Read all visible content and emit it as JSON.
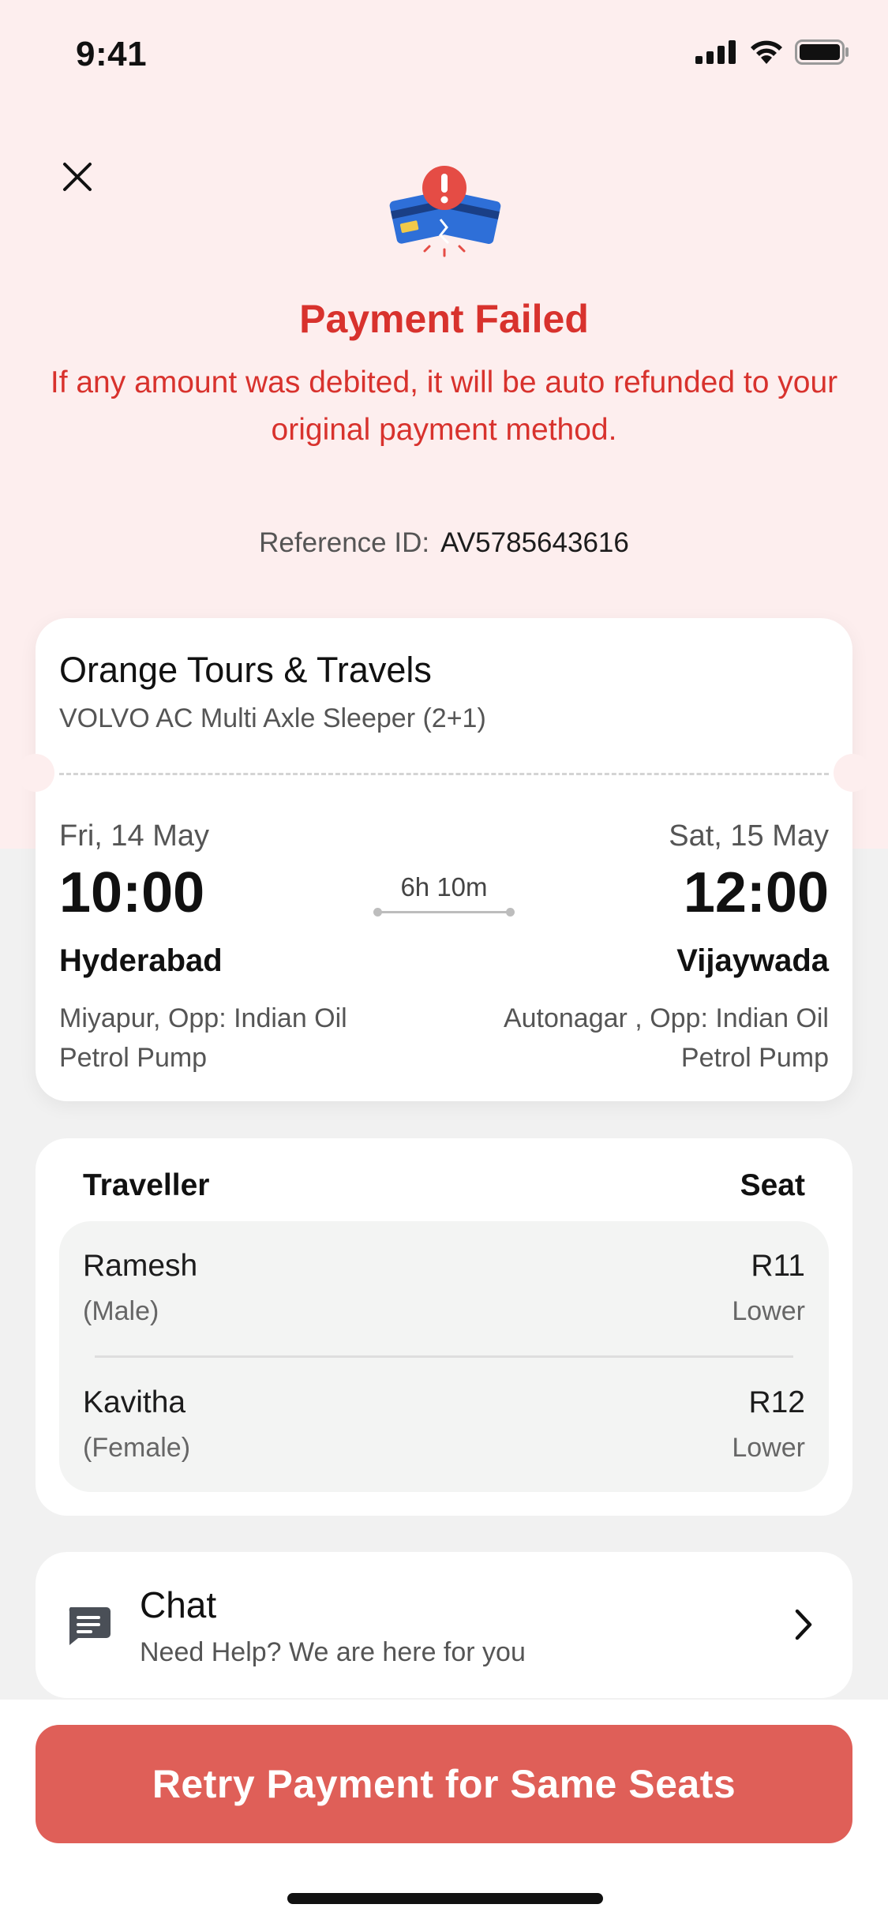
{
  "status_bar": {
    "time": "9:41"
  },
  "header": {
    "title": "Payment Failed",
    "message": "If any amount was debited, it will be auto refunded to your original payment method.",
    "reference_label": "Reference ID:",
    "reference_id": "AV5785643616"
  },
  "trip": {
    "operator": "Orange Tours & Travels",
    "bus_type": "VOLVO AC Multi Axle Sleeper (2+1)",
    "departure": {
      "date": "Fri, 14 May",
      "time": "10:00",
      "city": "Hyderabad",
      "point": "Miyapur, Opp: Indian Oil Petrol Pump"
    },
    "arrival": {
      "date": "Sat, 15 May",
      "time": "12:00",
      "city": "Vijaywada",
      "point": "Autonagar , Opp: Indian Oil Petrol Pump"
    },
    "duration": "6h 10m"
  },
  "travellers": {
    "header_traveller": "Traveller",
    "header_seat": "Seat",
    "items": [
      {
        "name": "Ramesh",
        "gender": "(Male)",
        "seat": "R11",
        "berth": "Lower"
      },
      {
        "name": "Kavitha",
        "gender": "(Female)",
        "seat": "R12",
        "berth": "Lower"
      }
    ]
  },
  "chat": {
    "title": "Chat",
    "subtitle": "Need Help? We are here for you"
  },
  "cta": {
    "label": "Retry Payment for Same Seats"
  },
  "colors": {
    "error": "#d8322d",
    "cta": "#df5f58",
    "page_top": "#fdeeee",
    "page_bottom": "#f1f1f1"
  }
}
